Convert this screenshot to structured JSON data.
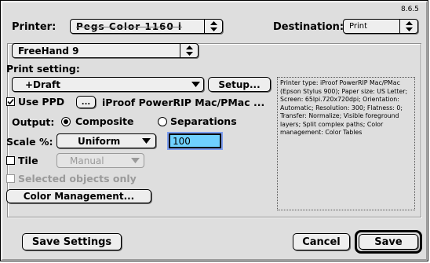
{
  "version": "8.6.5",
  "printer": {
    "label": "Printer:",
    "value": "Pegs Color 1160 i"
  },
  "destination": {
    "label": "Destination:",
    "value": "Print"
  },
  "app_menu": {
    "value": "FreeHand 9"
  },
  "print_setting": {
    "label": "Print setting:",
    "value": "+Draft",
    "setup_label": "Setup..."
  },
  "ppd": {
    "label": "Use PPD",
    "checked": true,
    "browse_label": "...",
    "name": "iProof PowerRIP Mac/PMac ..."
  },
  "output": {
    "label": "Output:",
    "composite": "Composite",
    "separations": "Separations",
    "selected": "Composite"
  },
  "scale": {
    "label": "Scale %:",
    "mode": "Uniform",
    "value": "100"
  },
  "tile": {
    "label": "Tile",
    "checked": false,
    "mode": "Manual"
  },
  "selected_only": {
    "label": "Selected objects only",
    "checked": false
  },
  "color_management_label": "Color Management...",
  "info_text": "Printer type: iProof PowerRIP Mac/PMac (Epson Stylus 900); Paper size: US Letter; Screen: 65lpi.720x720dpi; Orientation: Automatic; Resolution: 300; Flatness: 0; Transfer: Normalize; Visible foreground layers; Split complex paths; Color management: Color Tables",
  "buttons": {
    "save_settings": "Save Settings",
    "cancel": "Cancel",
    "save": "Save"
  },
  "colors": {
    "field_bg": "#6fd0ff",
    "dialog_bg": "#dedede"
  }
}
